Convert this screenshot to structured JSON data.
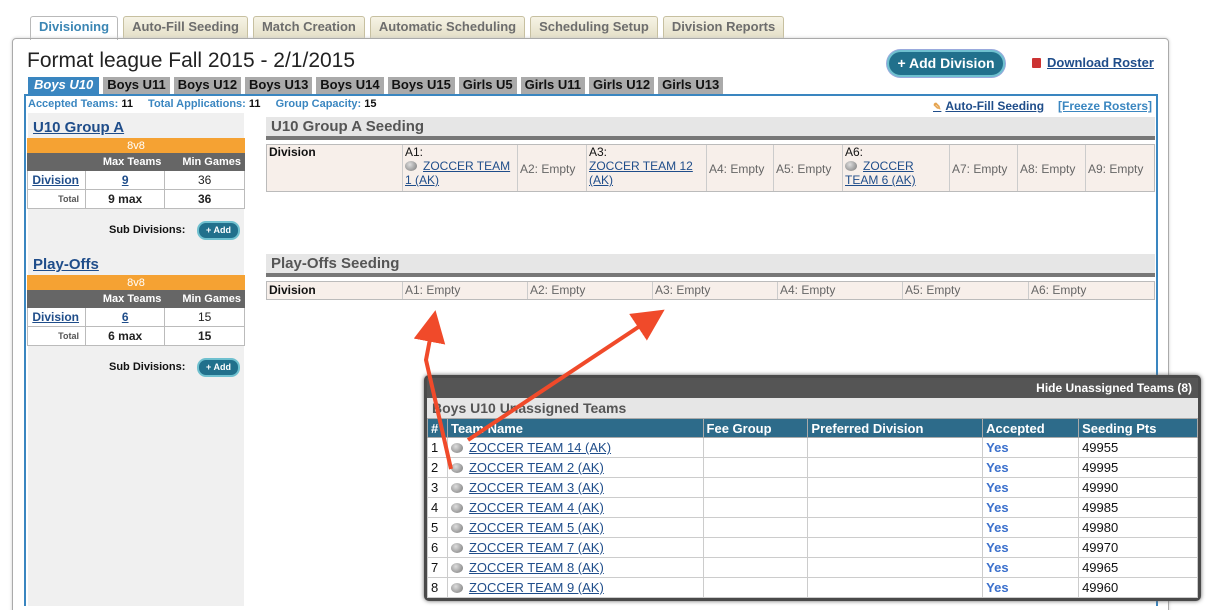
{
  "top_tabs": [
    "Divisioning",
    "Auto-Fill Seeding",
    "Match Creation",
    "Automatic Scheduling",
    "Scheduling Setup",
    "Division Reports"
  ],
  "page_title": "Format league Fall 2015 - 2/1/2015",
  "add_division_label": "+ Add Division",
  "download_roster_label": "Download Roster",
  "division_tabs": [
    "Boys U10",
    "Boys U11",
    "Boys U12",
    "Boys U13",
    "Boys U14",
    "Boys U15",
    "Girls U5",
    "Girls U11",
    "Girls U12",
    "Girls U13"
  ],
  "stats": {
    "accepted_label": "Accepted Teams:",
    "accepted_value": "11",
    "total_label": "Total Applications:",
    "total_value": "11",
    "capacity_label": "Group Capacity:",
    "capacity_value": "15"
  },
  "autofill_label": "Auto-Fill Seeding",
  "freeze_label": "[Freeze Rosters]",
  "groups": [
    {
      "title": "U10 Group A",
      "format": "8v8",
      "max_teams_label": "Max Teams",
      "min_games_label": "Min Games",
      "division_label": "Division",
      "max_teams": "9",
      "min_games": "36",
      "total_label": "Total",
      "total_max": "9 max",
      "total_games": "36",
      "sub_divisions_label": "Sub Divisions:",
      "add_label": "+ Add"
    },
    {
      "title": "Play-Offs",
      "format": "8v8",
      "max_teams_label": "Max Teams",
      "min_games_label": "Min Games",
      "division_label": "Division",
      "max_teams": "6",
      "min_games": "15",
      "total_label": "Total",
      "total_max": "6 max",
      "total_games": "15",
      "sub_divisions_label": "Sub Divisions:",
      "add_label": "+ Add"
    }
  ],
  "seedings": [
    {
      "title": "U10 Group A Seeding",
      "row_label": "Division",
      "slots": [
        {
          "label": "A1:",
          "team": "ZOCCER TEAM 1 (AK)"
        },
        {
          "label": "A2: Empty"
        },
        {
          "label": "A3:",
          "team": "ZOCCER TEAM 12 (AK)"
        },
        {
          "label": "A4: Empty"
        },
        {
          "label": "A5: Empty"
        },
        {
          "label": "A6:",
          "team": "ZOCCER TEAM 6 (AK)"
        },
        {
          "label": "A7: Empty"
        },
        {
          "label": "A8: Empty"
        },
        {
          "label": "A9: Empty"
        }
      ]
    },
    {
      "title": "Play-Offs Seeding",
      "row_label": "Division",
      "slots": [
        {
          "label": "A1: Empty"
        },
        {
          "label": "A2: Empty"
        },
        {
          "label": "A3: Empty"
        },
        {
          "label": "A4: Empty"
        },
        {
          "label": "A5: Empty"
        },
        {
          "label": "A6: Empty"
        }
      ]
    }
  ],
  "unassigned": {
    "hide_label": "Hide Unassigned Teams (8)",
    "title": "Boys U10 Unassigned Teams",
    "columns": [
      "#",
      "Team Name",
      "Fee Group",
      "Preferred Division",
      "Accepted",
      "Seeding Pts"
    ],
    "rows": [
      {
        "n": "1",
        "team": "ZOCCER TEAM 14 (AK)",
        "fee": "",
        "pref": "",
        "accepted": "Yes",
        "pts": "49955"
      },
      {
        "n": "2",
        "team": "ZOCCER TEAM 2 (AK)",
        "fee": "",
        "pref": "",
        "accepted": "Yes",
        "pts": "49995"
      },
      {
        "n": "3",
        "team": "ZOCCER TEAM 3 (AK)",
        "fee": "",
        "pref": "",
        "accepted": "Yes",
        "pts": "49990"
      },
      {
        "n": "4",
        "team": "ZOCCER TEAM 4 (AK)",
        "fee": "",
        "pref": "",
        "accepted": "Yes",
        "pts": "49985"
      },
      {
        "n": "5",
        "team": "ZOCCER TEAM 5 (AK)",
        "fee": "",
        "pref": "",
        "accepted": "Yes",
        "pts": "49980"
      },
      {
        "n": "6",
        "team": "ZOCCER TEAM 7 (AK)",
        "fee": "",
        "pref": "",
        "accepted": "Yes",
        "pts": "49970"
      },
      {
        "n": "7",
        "team": "ZOCCER TEAM 8 (AK)",
        "fee": "",
        "pref": "",
        "accepted": "Yes",
        "pts": "49965"
      },
      {
        "n": "8",
        "team": "ZOCCER TEAM 9 (AK)",
        "fee": "",
        "pref": "",
        "accepted": "Yes",
        "pts": "49960"
      }
    ]
  },
  "colors": {
    "accent": "#3a86c0",
    "button": "#21708c",
    "format_bar": "#f5a233",
    "annotation_arrow": "#f04a2a"
  }
}
